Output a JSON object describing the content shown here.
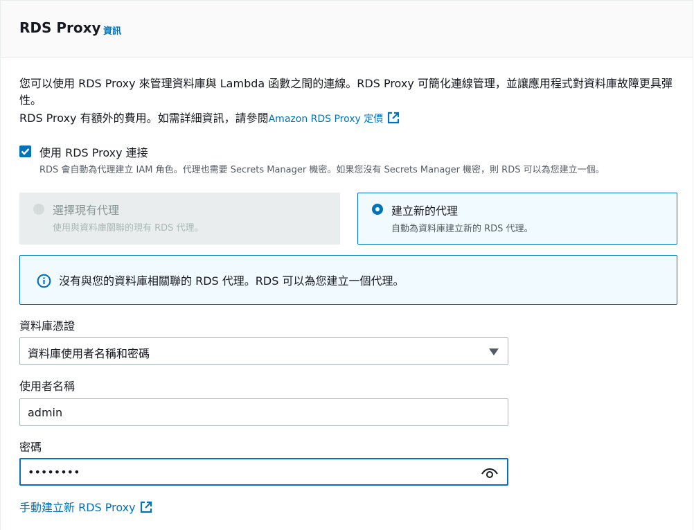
{
  "header": {
    "title": "RDS Proxy",
    "info_link": "資訊"
  },
  "description": {
    "line1": "您可以使用 RDS Proxy 來管理資料庫與 Lambda 函數之間的連線。RDS Proxy 可簡化連線管理，並讓應用程式對資料庫故障更具彈性。",
    "line2_prefix": "RDS Proxy 有額外的費用。如需詳細資訊，請參閱",
    "line2_link": "Amazon RDS Proxy 定價"
  },
  "use_proxy": {
    "label": "使用 RDS Proxy 連接",
    "hint": "RDS 會自動為代理建立 IAM 角色。代理也需要 Secrets Manager 機密。如果您沒有 Secrets Manager 機密，則 RDS 可以為您建立一個。",
    "checked": true
  },
  "proxy_options": {
    "existing": {
      "title": "選擇現有代理",
      "description": "使用與資料庫關聯的現有 RDS 代理。",
      "disabled": true
    },
    "create": {
      "title": "建立新的代理",
      "description": "自動為資料庫建立新的 RDS 代理。",
      "selected": true
    }
  },
  "alert": {
    "text": "沒有與您的資料庫相關聯的 RDS 代理。RDS 可以為您建立一個代理。"
  },
  "credentials": {
    "label": "資料庫憑證",
    "selected": "資料庫使用者名稱和密碼"
  },
  "username": {
    "label": "使用者名稱",
    "value": "admin"
  },
  "password": {
    "label": "密碼",
    "value": "••••••••"
  },
  "manual_link": "手動建立新 RDS Proxy",
  "colors": {
    "accent": "#0073bb",
    "text": "#16191f",
    "muted": "#545b64",
    "alert_bg": "#f1faff"
  }
}
